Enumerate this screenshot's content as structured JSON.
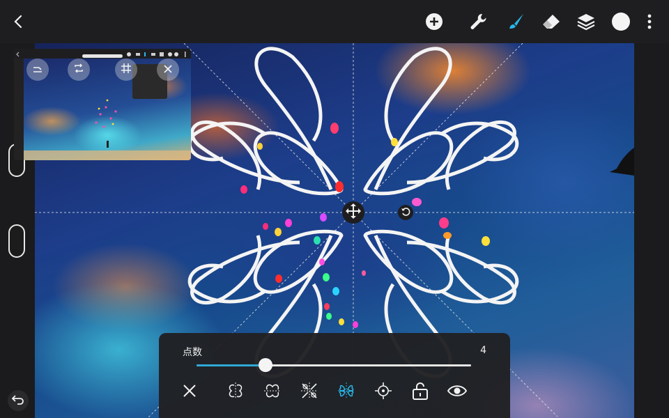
{
  "topbar": {
    "back_icon": "chevron-left-icon",
    "add_icon": "plus-circle-icon",
    "settings_icon": "wrench-icon",
    "brush_icon": "brush-icon",
    "eraser_icon": "eraser-icon",
    "layers_icon": "layers-icon",
    "color_icon": "color-swatch-icon",
    "more_icon": "more-vertical-icon",
    "accent_color": "#29b6e8",
    "swatch_color": "#f4f4f4"
  },
  "reference": {
    "menu_items": [
      "",
      "",
      ""
    ],
    "buttons": [
      "minimize-icon",
      "flip-icon",
      "grid-icon",
      "close-icon"
    ]
  },
  "canvas": {
    "transform_icon": "move-arrows-icon",
    "rotate_icon": "rotate-icon"
  },
  "symmetry_panel": {
    "label": "点数",
    "value": "4",
    "slider_fraction": 0.25,
    "modes": [
      "close-icon",
      "vertical-symmetry-icon",
      "horizontal-symmetry-icon",
      "quadrant-symmetry-icon",
      "radial-symmetry-icon",
      "center-point-icon",
      "lock-icon",
      "eye-icon"
    ]
  },
  "rail": {
    "undo_icon": "undo-icon"
  }
}
